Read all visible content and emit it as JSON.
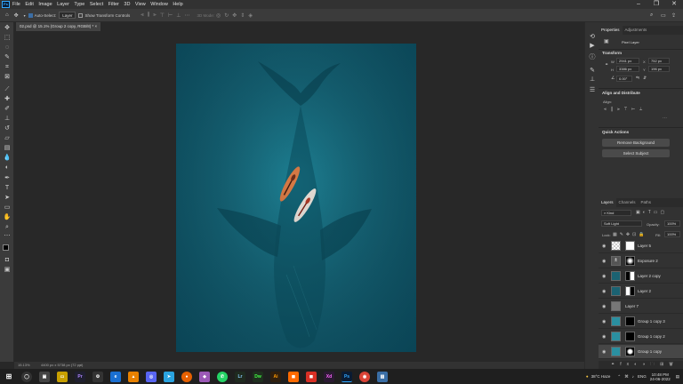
{
  "menubar": {
    "items": [
      "File",
      "Edit",
      "Image",
      "Layer",
      "Type",
      "Select",
      "Filter",
      "3D",
      "View",
      "Window",
      "Help"
    ],
    "app_icon": "Ps"
  },
  "options": {
    "auto_select": "Auto-Select:",
    "auto_select_target": "Layer",
    "transform_controls": "Show Transform Controls",
    "mode_3d": "3D Mode:"
  },
  "document": {
    "tab_title": "02.psd @ 15.1% (Group 2 copy, RGB/8) *"
  },
  "status": {
    "zoom": "15.13%",
    "dimensions": "4400 px x 5738 px (72 ppi)"
  },
  "properties": {
    "tabs": [
      "Properties",
      "Adjustments"
    ],
    "kind": "Pixel Layer",
    "transform_title": "Transform",
    "w": "2941 px",
    "h": "3386 px",
    "x": "752 px",
    "y": "196 px",
    "angle": "0.00°",
    "align_title": "Align and Distribute",
    "align_label": "Align:",
    "quick_title": "Quick Actions",
    "remove_bg": "Remove Background",
    "select_subject": "Select Subject"
  },
  "layers": {
    "tabs": [
      "Layers",
      "Channels",
      "Paths"
    ],
    "filter_kind": "Kind",
    "blend": "Soft Light",
    "opacity_label": "Opacity:",
    "opacity": "100%",
    "lock_label": "Lock:",
    "fill_label": "Fill:",
    "fill": "100%",
    "rows": [
      {
        "name": "Layer 5",
        "thumb": "checker"
      },
      {
        "name": "Exposure 2",
        "thumb": "adjust"
      },
      {
        "name": "Layer 2 copy",
        "thumb": "blue"
      },
      {
        "name": "Layer 2",
        "thumb": "blue"
      },
      {
        "name": "Layer 7",
        "thumb": "gray"
      },
      {
        "name": "Group 1 copy 3",
        "thumb": "teal"
      },
      {
        "name": "Group 1 copy 2",
        "thumb": "teal"
      },
      {
        "name": "Group 1 copy",
        "thumb": "teal"
      },
      {
        "name": "Group 1",
        "thumb": "folder"
      }
    ]
  },
  "tray": {
    "weather": "38°C  Haze",
    "lang": "ENG",
    "time": "10:48 PM",
    "date": "24-06-2022"
  }
}
